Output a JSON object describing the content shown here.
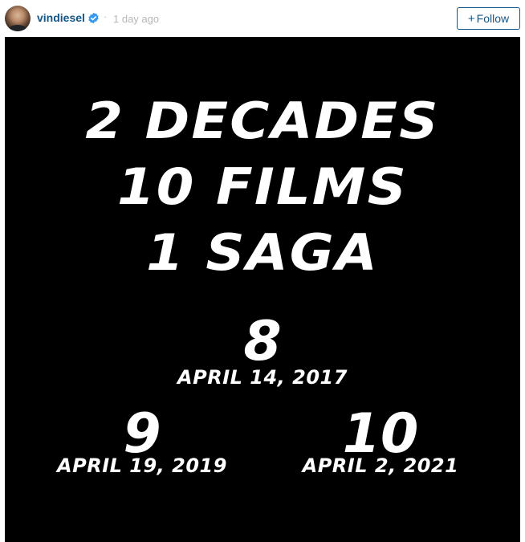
{
  "post": {
    "username": "vindiesel",
    "separator": "·",
    "time": "1 day ago",
    "follow": {
      "plus": "+",
      "label": "Follow"
    }
  },
  "image": {
    "headline": [
      "2 DECADES",
      "10 FILMS",
      "1 SAGA"
    ],
    "films": [
      {
        "number": "8",
        "date": "APRIL 14, 2017"
      },
      {
        "number": "9",
        "date": "APRIL 19, 2019"
      },
      {
        "number": "10",
        "date": "APRIL 2, 2021"
      }
    ]
  },
  "colors": {
    "link": "#125688",
    "muted": "#b7b7b7",
    "verified": "#3897f0",
    "media_bg": "#000000",
    "media_text": "#ffffff"
  },
  "icons": {
    "verified": "verified-badge-icon",
    "avatar": "profile-avatar"
  }
}
